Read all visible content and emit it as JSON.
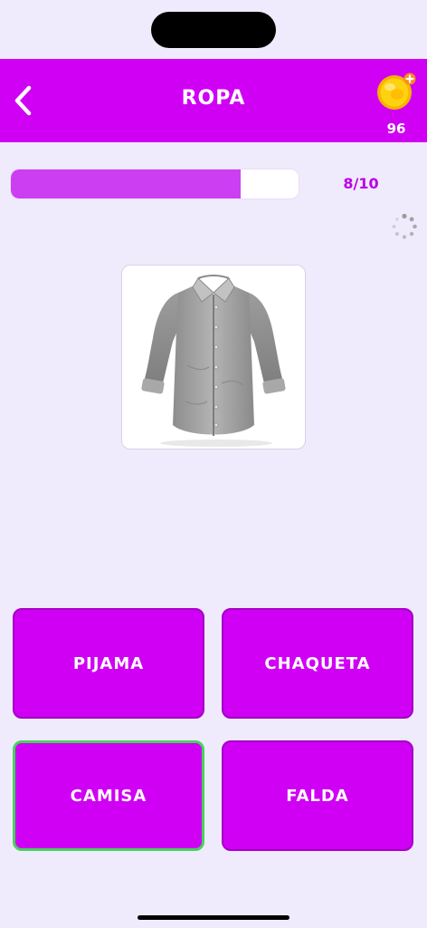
{
  "header": {
    "title": "ROPA",
    "coins": "96"
  },
  "progress": {
    "label": "8/10",
    "fraction": 0.8
  },
  "question": {
    "image": "shirt-image"
  },
  "answers": [
    {
      "label": "PIJAMA",
      "correct": false
    },
    {
      "label": "CHAQUETA",
      "correct": false
    },
    {
      "label": "CAMISA",
      "correct": true
    },
    {
      "label": "FALDA",
      "correct": false
    }
  ],
  "colors": {
    "brand": "#d000f5",
    "background": "#f0ebfc",
    "progress": "#cc3ef2",
    "correct_border": "#45d35c"
  }
}
